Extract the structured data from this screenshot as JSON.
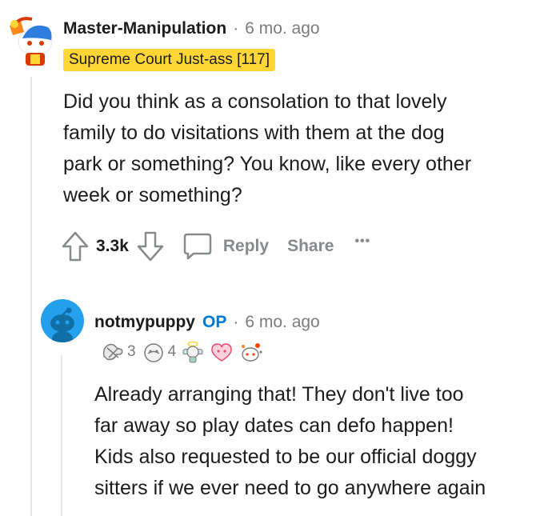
{
  "comment": {
    "author": "Master-Manipulation",
    "separator": "·",
    "time": "6 mo. ago",
    "flair": "Supreme Court Just-ass [117]",
    "body": [
      "Did you think as a consolation to that lovely",
      "family to do visitations with them at the dog",
      "park or something? You know, like every other",
      "week or something?"
    ],
    "votes": "3.3k",
    "reply_label": "Reply",
    "share_label": "Share",
    "more_label": "•••"
  },
  "reply": {
    "author": "notmypuppy",
    "op_badge": "OP",
    "separator": "·",
    "time": "6 mo. ago",
    "awards": [
      {
        "icon": "wholesome-seal-icon",
        "count": "3"
      },
      {
        "icon": "bless-up-icon",
        "count": "4"
      },
      {
        "icon": "angel-icon",
        "count": ""
      },
      {
        "icon": "heart-eyes-icon",
        "count": ""
      },
      {
        "icon": "snoo-party-icon",
        "count": ""
      }
    ],
    "body": [
      "Already arranging that! They don't live too",
      "far away so play dates can defo happen!",
      "Kids also requested to be our official doggy",
      "sitters if we ever need to go anywhere again"
    ]
  },
  "colors": {
    "flair_bg": "#ffd635",
    "op_blue": "#0079d3",
    "meta_gray": "#7c7c7c",
    "action_gray": "#878a8c",
    "avatar_teal": "#24a0ed"
  }
}
